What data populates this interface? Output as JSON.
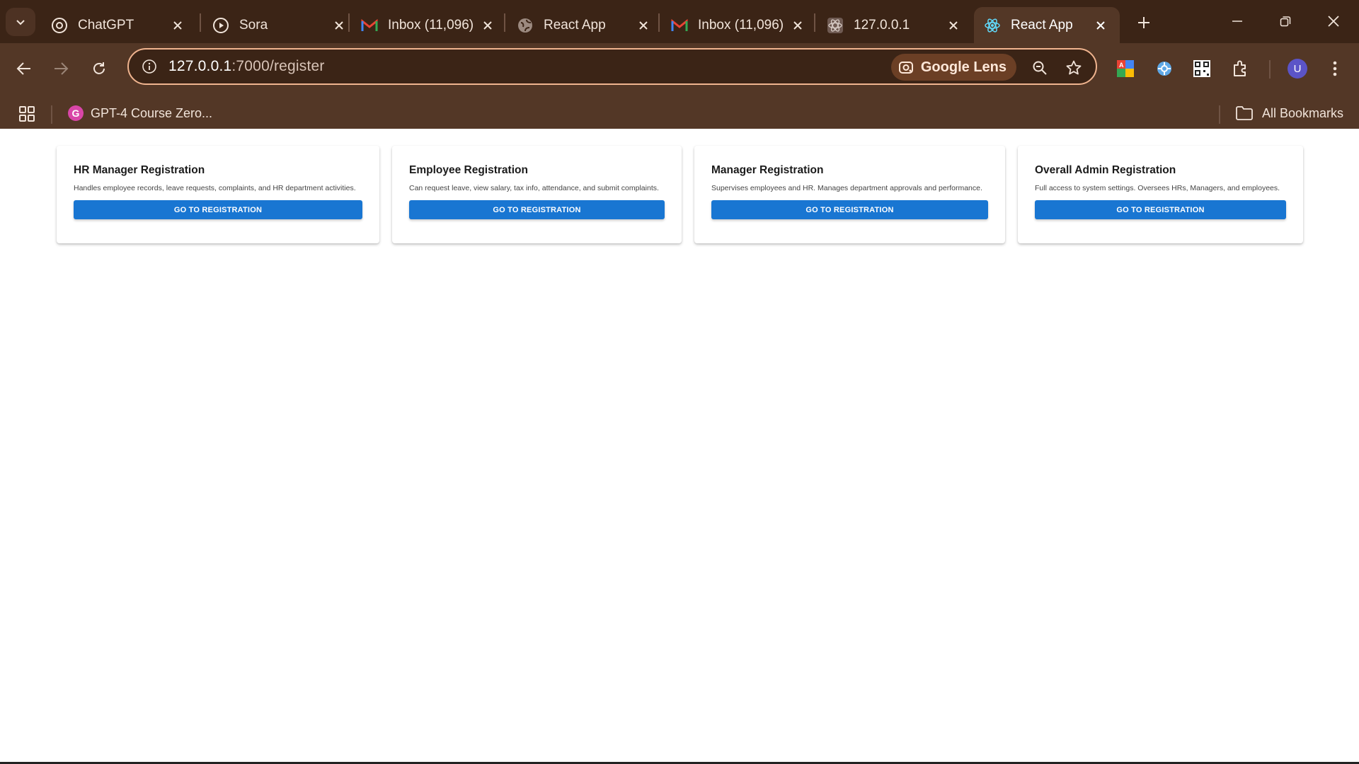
{
  "browser": {
    "tabs": [
      {
        "title": "ChatGPT",
        "icon": "chatgpt-icon"
      },
      {
        "title": "Sora",
        "icon": "sora-icon"
      },
      {
        "title": "Inbox (11,096)",
        "icon": "gmail-icon"
      },
      {
        "title": "React App",
        "icon": "globe-icon"
      },
      {
        "title": "Inbox (11,096)",
        "icon": "gmail-icon"
      },
      {
        "title": "127.0.0.1",
        "icon": "react-icon"
      },
      {
        "title": "React App",
        "icon": "react-icon",
        "active": true
      }
    ],
    "url_host": "127.0.0.1",
    "url_path": ":7000/register",
    "lens_label": "Google Lens",
    "avatar_initial": "U",
    "bookmarks": [
      {
        "label": "GPT-4 Course Zero...",
        "icon": "g-icon",
        "icon_letter": "G"
      }
    ],
    "all_bookmarks_label": "All Bookmarks",
    "colors": {
      "frame": "#3b2416",
      "toolbar": "#533726",
      "omnibox_border": "#f0b48f",
      "accent": "#1976d2"
    }
  },
  "cards": [
    {
      "title": "HR Manager Registration",
      "description": "Handles employee records, leave requests, complaints, and HR department activities.",
      "button": "GO TO REGISTRATION"
    },
    {
      "title": "Employee Registration",
      "description": "Can request leave, view salary, tax info, attendance, and submit complaints.",
      "button": "GO TO REGISTRATION"
    },
    {
      "title": "Manager Registration",
      "description": "Supervises employees and HR. Manages department approvals and performance.",
      "button": "GO TO REGISTRATION"
    },
    {
      "title": "Overall Admin Registration",
      "description": "Full access to system settings. Oversees HRs, Managers, and employees.",
      "button": "GO TO REGISTRATION"
    }
  ]
}
